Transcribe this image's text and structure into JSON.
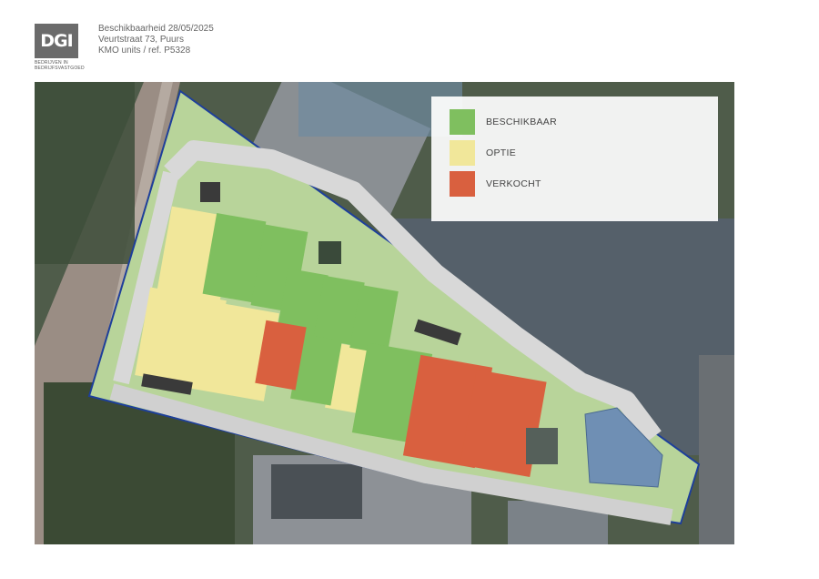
{
  "logo": {
    "text": "DGI",
    "subtitle_line1": "BEDRIJVEN IN",
    "subtitle_line2": "BEDRIJFSVASTGOED"
  },
  "header": {
    "line1": "Beschikbaarheid  28/05/2025",
    "line2": "Veurtstraat 73, Puurs",
    "line3": "KMO units / ref. P5328"
  },
  "legend": {
    "items": [
      {
        "label": "BESCHIKBAAR",
        "color": "#7fbf5f"
      },
      {
        "label": "OPTIE",
        "color": "#f1e79a"
      },
      {
        "label": "VERKOCHT",
        "color": "#d9603f"
      }
    ]
  },
  "colors": {
    "beschikbaar": "#7fbf5f",
    "optie": "#f1e79a",
    "verkocht": "#d9603f",
    "site_grass": "#b8d49a",
    "road": "#d8d8d8",
    "boundary": "#1e3f9a"
  }
}
